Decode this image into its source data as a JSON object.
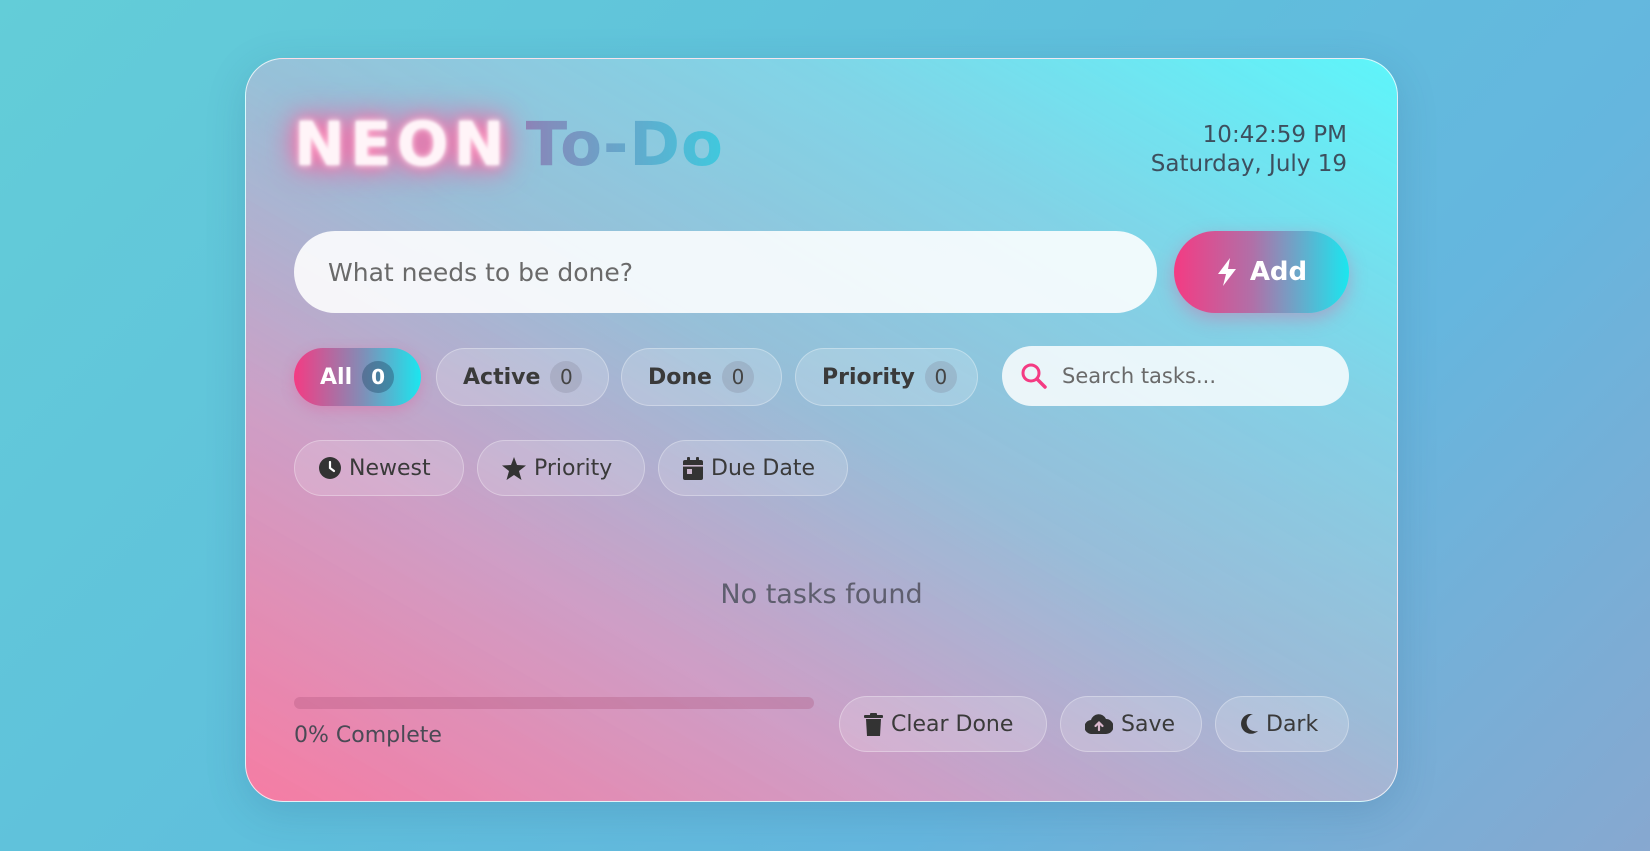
{
  "header": {
    "title_neon": "NEON",
    "title_todo": "To-Do",
    "time": "10:42:59 PM",
    "date": "Saturday, July 19"
  },
  "new_task": {
    "placeholder": "What needs to be done?",
    "add_label": "Add"
  },
  "filters": [
    {
      "label": "All",
      "count": "0",
      "active": true
    },
    {
      "label": "Active",
      "count": "0",
      "active": false
    },
    {
      "label": "Done",
      "count": "0",
      "active": false
    },
    {
      "label": "Priority",
      "count": "0",
      "active": false
    }
  ],
  "search": {
    "placeholder": "Search tasks..."
  },
  "sort": [
    {
      "label": "Newest",
      "icon": "clock-icon"
    },
    {
      "label": "Priority",
      "icon": "star-icon"
    },
    {
      "label": "Due Date",
      "icon": "calendar-icon"
    }
  ],
  "empty_message": "No tasks found",
  "progress": {
    "percent": 0,
    "label": "0% Complete"
  },
  "footer": {
    "clear_label": "Clear Done",
    "save_label": "Save",
    "theme_label": "Dark"
  },
  "colors": {
    "accent_pink": "#f43b83",
    "accent_cyan": "#1be6ef"
  }
}
